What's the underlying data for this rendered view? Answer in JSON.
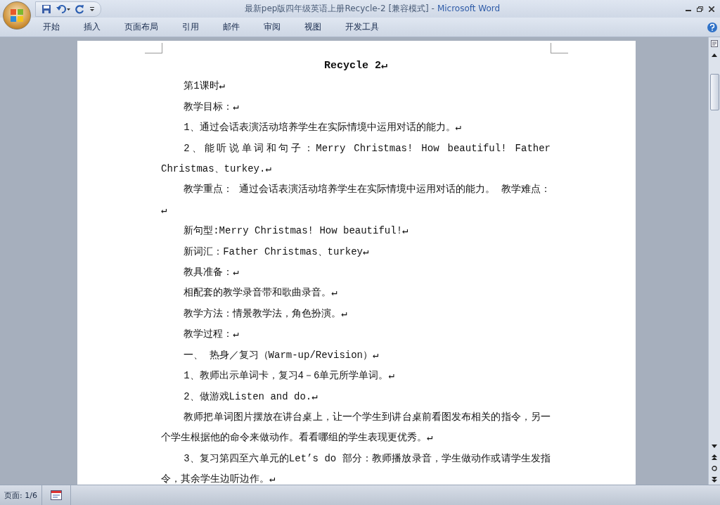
{
  "window": {
    "title": "最新pep版四年级英语上册Recycle-2 [兼容模式] -",
    "app": "Microsoft Word"
  },
  "ribbon_tabs": [
    {
      "label": "开始",
      "selected": false
    },
    {
      "label": "插入",
      "selected": false
    },
    {
      "label": "页面布局",
      "selected": false
    },
    {
      "label": "引用",
      "selected": false
    },
    {
      "label": "邮件",
      "selected": false
    },
    {
      "label": "审阅",
      "selected": false
    },
    {
      "label": "视图",
      "selected": false
    },
    {
      "label": "开发工具",
      "selected": false
    }
  ],
  "document": {
    "title": "Recycle 2↵",
    "paragraphs": [
      "第1课时↵",
      "教学目标：↵",
      "1、通过会话表演活动培养学生在实际情境中运用对话的能力。↵",
      "2、能听说单词和句子：Merry Christmas! How beautiful! Father Christmas、turkey.↵",
      "教学重点： 通过会话表演活动培养学生在实际情境中运用对话的能力。 教学难点：↵",
      "新句型:Merry Christmas! How beautiful!↵",
      "新词汇：Father Christmas、turkey↵",
      "教具准备：↵",
      "相配套的教学录音带和歌曲录音。↵",
      "教学方法：情景教学法，角色扮演。↵",
      "教学过程：↵",
      "一、 热身／复习（Warm-up/Revision）↵",
      "1、教师出示单词卡，复习4－6单元所学单词。↵",
      "2、做游戏Listen and do.↵",
      "教师把单词图片摆放在讲台桌上，让一个学生到讲台桌前看图发布相关的指令，另一个学生根据他的命令来做动作。看看哪组的学生表现更优秀。↵",
      "3、复习第四至六单元的Let’s do 部分：教师播放录音，学生做动作或请学生发指令，其余学生边听边作。↵"
    ]
  },
  "status_bar": {
    "page": "页面: 1/6"
  }
}
